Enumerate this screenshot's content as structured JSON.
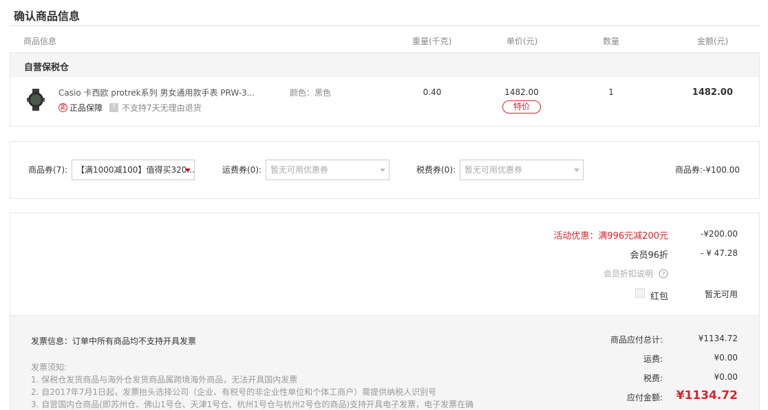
{
  "page_title": "确认商品信息",
  "columns": [
    "商品信息",
    "重量(千克)",
    "单价(元)",
    "数量",
    "金额(元)"
  ],
  "warehouse": "自营保税仓",
  "item": {
    "name": "Casio 卡西欧 protrek系列 男女通用款手表 PRW-3...",
    "attr": "颜色：黑色",
    "weight": "0.40",
    "price": "1482.00",
    "price_tag": "特价",
    "quantity": "1",
    "amount": "1482.00",
    "guarantee": "正品保障",
    "guarantee_icon_text": "正",
    "no_return": "不支持7天无理由退货",
    "no_return_icon_text": "?"
  },
  "coupons": {
    "goods_label": "商品券(7):",
    "goods_selected": "【满1000减100】值得买320...",
    "shipping_label": "运费券(0):",
    "shipping_placeholder": "暂无可用优惠券",
    "tax_label": "税费券(0):",
    "tax_placeholder": "暂无可用优惠券",
    "goods_total": "商品券:-¥100.00"
  },
  "discounts": {
    "activity_label": "活动优惠：满996元减200元",
    "activity_value": "-¥200.00",
    "member_label": "会员96折",
    "member_value": "- ¥ 47.28",
    "member_help": "会员折扣说明",
    "redpacket_label": "红包",
    "redpacket_value": "暂无可用"
  },
  "invoice": {
    "title": "发票信息：订单中所有商品均不支持开具发票",
    "notice_title": "发票须知:",
    "notes": [
      "1. 保税仓发货商品与海外仓发货商品属跨境海外商品，无法开具国内发票",
      "2. 自2017年7月1日起，发票抬头选择公司（企业、有税号的非企业性单位和个体工商户）需提供纳税人识别号",
      "3. 自营国内仓商品(即苏州仓、佛山1号仓、天津1号仓、杭州1号仓与杭州2号仓的商品)支持开具电子发票，电子发票在确"
    ]
  },
  "summary": {
    "goods_total_label": "商品应付总计:",
    "goods_total_value": "¥1134.72",
    "shipping_label": "运费:",
    "shipping_value": "¥0.00",
    "tax_label": "税费:",
    "tax_value": "¥0.00",
    "pay_label": "应付金额:",
    "pay_value": "¥1134.72"
  },
  "colors": {
    "accent": "#d9232d",
    "panel": "#f5f5f5",
    "border": "#e6e6e6"
  }
}
